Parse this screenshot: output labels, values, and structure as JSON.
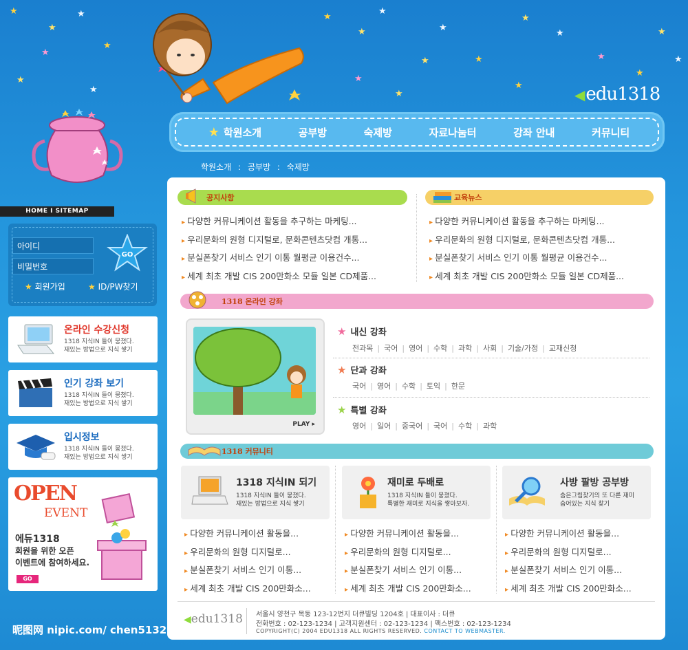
{
  "brand": {
    "logo": "edu1318",
    "watermark": "昵图网 nipic.com/ chen5132"
  },
  "nav": {
    "items": [
      "학원소개",
      "공부방",
      "숙제방",
      "자료나눔터",
      "강좌 안내",
      "커뮤니티"
    ]
  },
  "breadcrumb": [
    "학원소개",
    "공부방",
    "숙제방"
  ],
  "breadcrumb_sep": ":",
  "left": {
    "homebar": "HOME  I  SITEMAP",
    "login": {
      "id_label": "아이디",
      "pw_label": "비밀번호",
      "go": "GO",
      "join": "회원가입",
      "find": "ID/PW찾기"
    },
    "cards": [
      {
        "title": "온라인 수강신청",
        "color": "#e0362a",
        "line1": "1318 지식IN 들이 뭉쳤다.",
        "line2": "재있는 방법으로 지식 쌓기"
      },
      {
        "title": "인기 강좌 보기",
        "color": "#1a6bbf",
        "line1": "1318 지식IN 들이 뭉쳤다.",
        "line2": "재있는 방법으로 지식 쌓기"
      },
      {
        "title": "입시정보",
        "color": "#1a6bbf",
        "line1": "1318 지식IN 들이 뭉쳤다.",
        "line2": "재있는 방법으로 지식 쌓기"
      }
    ],
    "event": {
      "open": "OPEN",
      "event": "EVENT",
      "line1": "에듀1318",
      "line2": "회원을 위한 오픈",
      "line3": "이벤트에 참여하세요.",
      "go": "GO"
    }
  },
  "notice": {
    "title": "공지사항",
    "items": [
      "다양한 커뮤니케이션 활동을 추구하는 마케팅...",
      "우리문화의 원형 디지털로, 문화콘텐츠닷컴 개통...",
      "분실폰찾기 서비스 인기 이통 월평균 이용건수...",
      "세계 최초 개발 CIS 200만화소 모듈 일본 CD제품..."
    ]
  },
  "news": {
    "title": "교육뉴스",
    "items": [
      "다양한 커뮤니케이션 활동을 추구하는 마케팅...",
      "우리문화의 원형 디지털로, 문화콘텐츠닷컴 개통...",
      "분실폰찾기 서비스 인기 이통 월평균 이용건수...",
      "세계 최초 개발 CIS 200만화소 모듈 일본 CD제품..."
    ]
  },
  "online": {
    "title": "1318 온라인 강좌",
    "play": "PLAY",
    "courses": [
      {
        "title": "내신 강좌",
        "star_color": "#f06a9c",
        "subjects": [
          "전과목",
          "국어",
          "영어",
          "수학",
          "과학",
          "사회",
          "기술/가정",
          "교재신청"
        ]
      },
      {
        "title": "단과 강좌",
        "star_color": "#f07a50",
        "subjects": [
          "국어",
          "영어",
          "수학",
          "토익",
          "한문"
        ]
      },
      {
        "title": "특별 강좌",
        "star_color": "#9bd34a",
        "subjects": [
          "영어",
          "일어",
          "중국어",
          "국어",
          "수학",
          "과학"
        ]
      }
    ]
  },
  "community": {
    "title": "1318 커뮤니티",
    "cards": [
      {
        "title": "1318 지식IN 되기",
        "line1": "1318 지식IN 들이 뭉쳤다.",
        "line2": "재있는 방법으로 지식 쌓기"
      },
      {
        "title": "재미로 두배로",
        "line1": "1318 지식IN 들이 뭉쳤다.",
        "line2": "특별한 재미로 지식을 쌓아보자."
      },
      {
        "title": "사방 팔방 공부방",
        "line1": "숨은그림찾기의 또 다른 재미",
        "line2": "숨어있는 지식 찾기"
      }
    ],
    "lists": [
      [
        "다양한 커뮤니케이션 활동을...",
        "우리문화의 원형 디지털로...",
        "분실폰찾기 서비스 인기 이통...",
        "세계 최초 개발 CIS 200만화소..."
      ],
      [
        "다양한 커뮤니케이션 활동을...",
        "우리문화의 원형 디지털로...",
        "분실폰찾기 서비스 인기 이통...",
        "세계 최초 개발 CIS 200만화소..."
      ],
      [
        "다양한 커뮤니케이션 활동을...",
        "우리문화의 원형 디지털로...",
        "분실폰찾기 서비스 인기 이통...",
        "세계 최초 개발 CIS 200만화소..."
      ]
    ]
  },
  "footer": {
    "logo": "edu1318",
    "line1": "서울시 양천구 목동 123-12번지 더큐빌딩 1204호   |   대표이사 : 더큐",
    "line2": "전화번호 : 02-123-1234   |   고객지원센터 : 02-123-1234   |   팩스번호 : 02-123-1234",
    "line3": "COPYRIGHT(C) 2004 EDU1318 ALL RIGHTS RESERVED.",
    "contact": "CONTACT TO WEBMASTER."
  }
}
